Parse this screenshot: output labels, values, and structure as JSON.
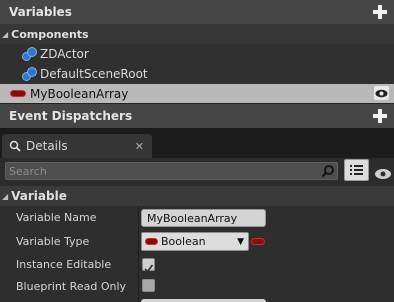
{
  "variables_header": "Variables",
  "components_header": "Components",
  "components": [
    {
      "label": "ZDActor"
    },
    {
      "label": "DefaultSceneRoot"
    }
  ],
  "selected_variable": "MyBooleanArray",
  "event_dispatchers_header": "Event Dispatchers",
  "details_tab": "Details",
  "search_placeholder": "Search",
  "variable_section": "Variable",
  "properties": {
    "name_label": "Variable Name",
    "name_value": "MyBooleanArray",
    "type_label": "Variable Type",
    "type_value": "Boolean",
    "instance_label": "Instance Editable",
    "readonly_label": "Blueprint Read Only"
  },
  "colors": {
    "boolean_pin": "#8a0b0b",
    "selected_row": "#b9b9b9",
    "header": "#464646"
  }
}
